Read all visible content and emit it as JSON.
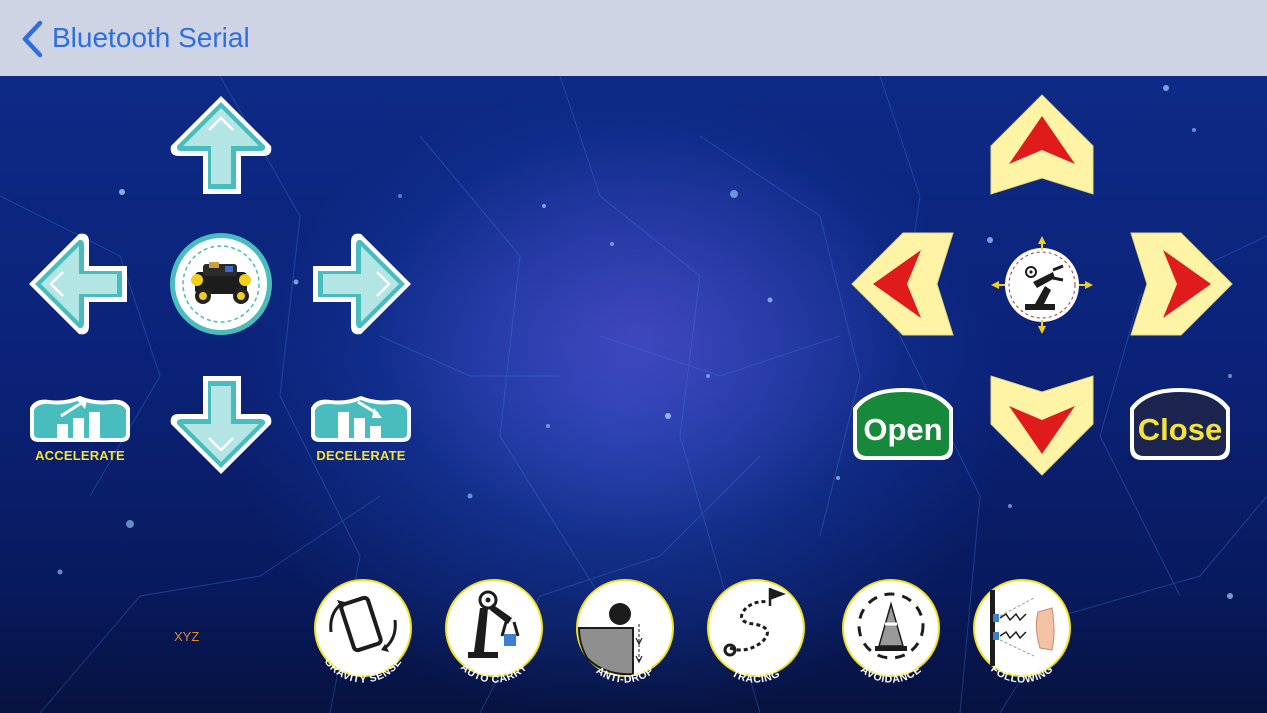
{
  "nav": {
    "back_label": "Bluetooth Serial"
  },
  "left_pad": {
    "accelerate_label": "ACCELERATE",
    "decelerate_label": "DECELERATE"
  },
  "right_pad": {
    "open_label": "Open",
    "close_label": "Close"
  },
  "xyz_label": "XYZ",
  "modes": [
    {
      "label": "GRAVITY SENSE"
    },
    {
      "label": "AUTO CARRY"
    },
    {
      "label": "ANTI-DROP"
    },
    {
      "label": "TRACING"
    },
    {
      "label": "AVOIDANCE"
    },
    {
      "label": "FOLLOWING"
    }
  ],
  "colors": {
    "nav_bg": "#cfd4e4",
    "nav_tint": "#2d6fe0",
    "teal": "#3fb8b8",
    "arrow_yellow": "#fff4a6",
    "arrow_red": "#e01b1b",
    "open_green": "#17893a",
    "close_navy": "#1b2550",
    "label_yellow": "#f4e33a",
    "mode_ring": "#f2e21e"
  }
}
